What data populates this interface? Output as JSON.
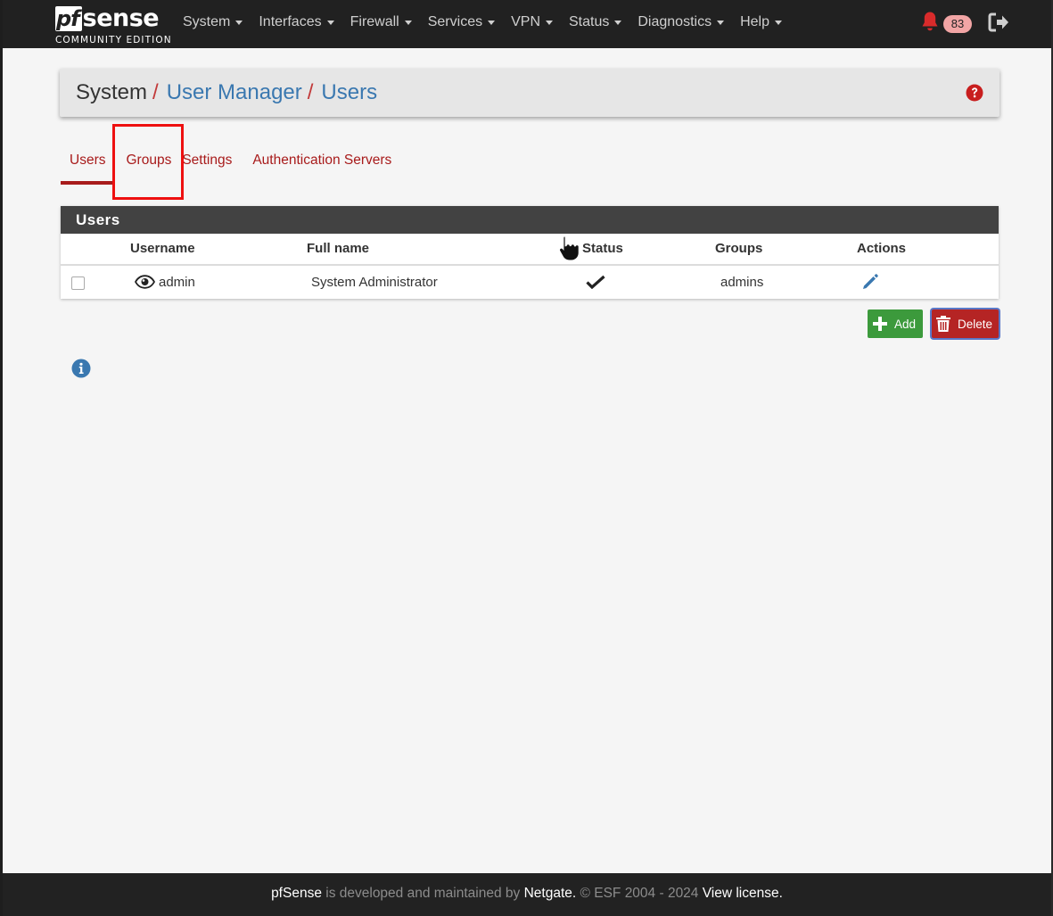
{
  "brand": {
    "logo_pf": "pf",
    "logo_sense": "sense",
    "edition": "COMMUNITY EDITION"
  },
  "nav": {
    "items": [
      {
        "label": "System"
      },
      {
        "label": "Interfaces"
      },
      {
        "label": "Firewall"
      },
      {
        "label": "Services"
      },
      {
        "label": "VPN"
      },
      {
        "label": "Status"
      },
      {
        "label": "Diagnostics"
      },
      {
        "label": "Help"
      }
    ],
    "notification_count": "83",
    "icons": {
      "bell": "bell-icon",
      "logout": "logout-icon"
    },
    "bell_color": "#d92b2b"
  },
  "breadcrumb": {
    "items": [
      {
        "label": "System",
        "separator": "/"
      },
      {
        "label": "User Manager",
        "separator": "/"
      },
      {
        "label": "Users"
      }
    ],
    "help_icon": "question-circle-icon"
  },
  "tabs": [
    {
      "label": "Users",
      "active": true
    },
    {
      "label": "Groups",
      "active": false
    },
    {
      "label": "Settings",
      "active": false
    },
    {
      "label": "Authentication Servers",
      "active": false
    }
  ],
  "users_panel": {
    "title": "Users",
    "columns": {
      "username": "Username",
      "full_name": "Full name",
      "status": "Status",
      "groups": "Groups",
      "actions": "Actions"
    },
    "rows": [
      {
        "username": "admin",
        "full_name": "System Administrator",
        "status": "check",
        "groups": "admins",
        "action_icon": "pencil-icon",
        "checked": false
      }
    ]
  },
  "buttons": {
    "add_label": "Add",
    "delete_label": "Delete"
  },
  "info_icon": "info-circle-icon",
  "footer": {
    "product": "pfSense",
    "text": " is developed and maintained by ",
    "company": "Netgate.",
    "copyright": " © ESF 2004 - 2024 ",
    "license_link": "View license."
  },
  "colors": {
    "navbar": "#212121",
    "accent_red": "#a81b1b",
    "link_blue": "#3a78b0",
    "add_green": "#3c9a3c",
    "delete_red": "#b52424",
    "panel_heading": "#424242"
  }
}
